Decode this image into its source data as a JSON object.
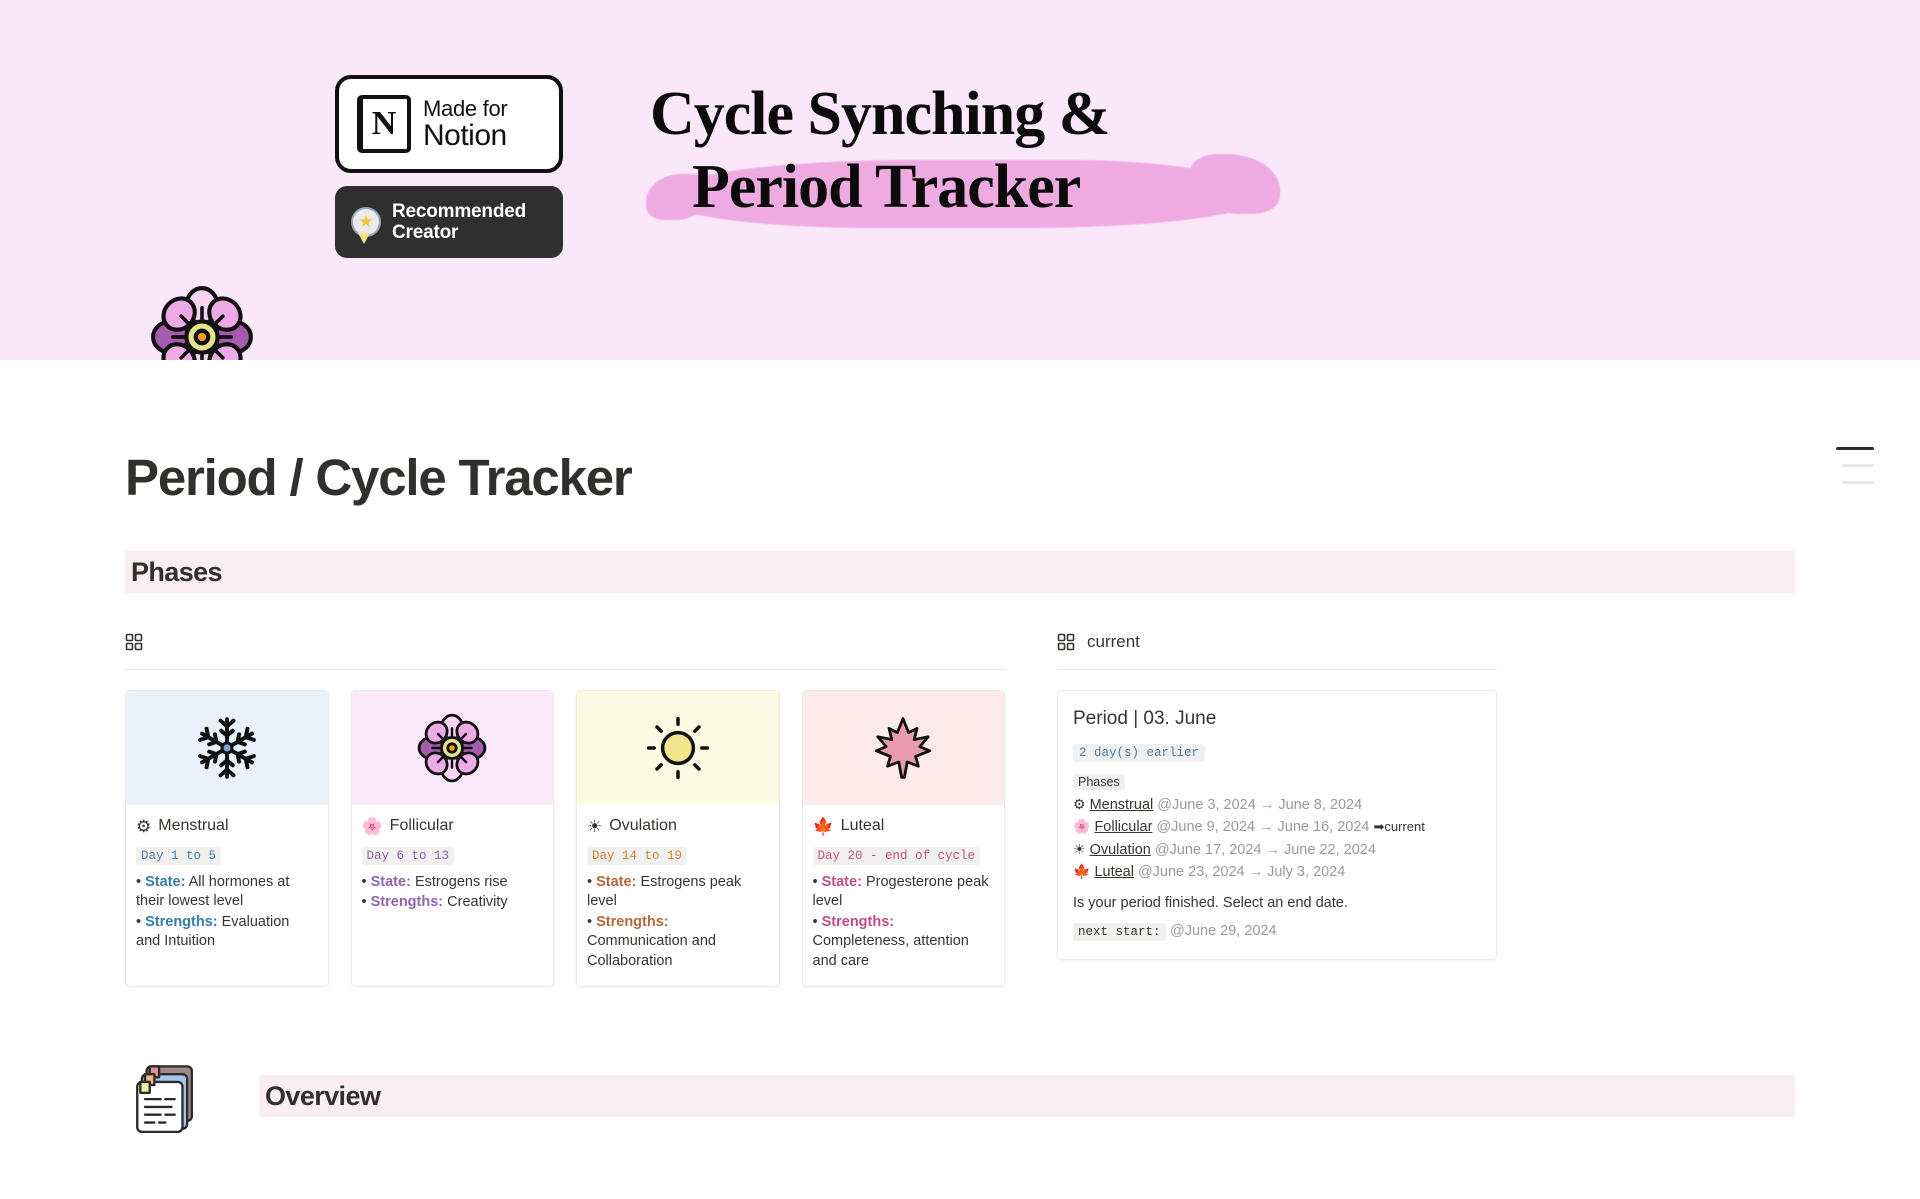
{
  "banner": {
    "notion_badge": {
      "line1": "Made for",
      "line2": "Notion",
      "logo_letter": "N"
    },
    "recommended_badge": {
      "line1": "Recommended",
      "line2": "Creator"
    },
    "title_line1": "Cycle Synching  &",
    "title_line2": "Period Tracker",
    "flower_icon": "flower-icon"
  },
  "page": {
    "title": "Period / Cycle Tracker",
    "section_phases": "Phases",
    "section_overview": "Overview"
  },
  "phases_db": {
    "view_label": "",
    "cards": [
      {
        "emoji": "⚙",
        "name": "Menstrual",
        "days": "Day 1 to 5",
        "state_label": "State:",
        "state_value": "All hormones at their lowest level",
        "strengths_label": "Strengths:",
        "strengths_value": "Evaluation and Intuition",
        "cover_icon": "snowflake-icon",
        "accent": "#337ea9"
      },
      {
        "emoji": "🌸",
        "name": "Follicular",
        "days": "Day 6 to 13",
        "state_label": "State:",
        "state_value": "Estrogens rise",
        "strengths_label": "Strengths:",
        "strengths_value": "Creativity",
        "cover_icon": "flower-icon",
        "accent": "#9065b0"
      },
      {
        "emoji": "☀",
        "name": "Ovulation",
        "days": "Day 14 to 19",
        "state_label": "State:",
        "state_value": "Estrogens peak level",
        "strengths_label": "Strengths:",
        "strengths_value": "Communication and Collaboration",
        "cover_icon": "sun-icon",
        "accent": "#b4693b"
      },
      {
        "emoji": "🍁",
        "name": "Luteal",
        "days": "Day 20 - end of cycle",
        "state_label": "State:",
        "state_value": "Progesterone peak level",
        "strengths_label": "Strengths:",
        "strengths_value": "Completeness, attention and care",
        "cover_icon": "maple-leaf-icon",
        "accent": "#c14c8a"
      }
    ]
  },
  "current": {
    "db_title": "current",
    "card_title": "Period | 03. June",
    "earlier_chip": "2 day(s) earlier",
    "phases_label": "Phases",
    "rows": [
      {
        "emoji": "⚙",
        "name": "Menstrual",
        "at": "@June 3, 2024",
        "arrow": "→",
        "end": "June 8, 2024",
        "flag": ""
      },
      {
        "emoji": "🌸",
        "name": "Follicular",
        "at": "@June 9, 2024",
        "arrow": "→",
        "end": "June 16, 2024",
        "flag": "➡current"
      },
      {
        "emoji": "☀",
        "name": "Ovulation",
        "at": "@June 17, 2024",
        "arrow": "→",
        "end": "June 22, 2024",
        "flag": ""
      },
      {
        "emoji": "🍁",
        "name": "Luteal",
        "at": "@June 23, 2024",
        "arrow": "→",
        "end": "July 3, 2024",
        "flag": ""
      }
    ],
    "note": "Is your period finished. Select an end date.",
    "next_start_label": "next start:",
    "next_start_value": "@June 29, 2024"
  },
  "colors": {
    "banner_bg": "#fae7fa",
    "brush": "#efa8e0",
    "section_bg": "#fbeef2",
    "text": "#37352f"
  }
}
